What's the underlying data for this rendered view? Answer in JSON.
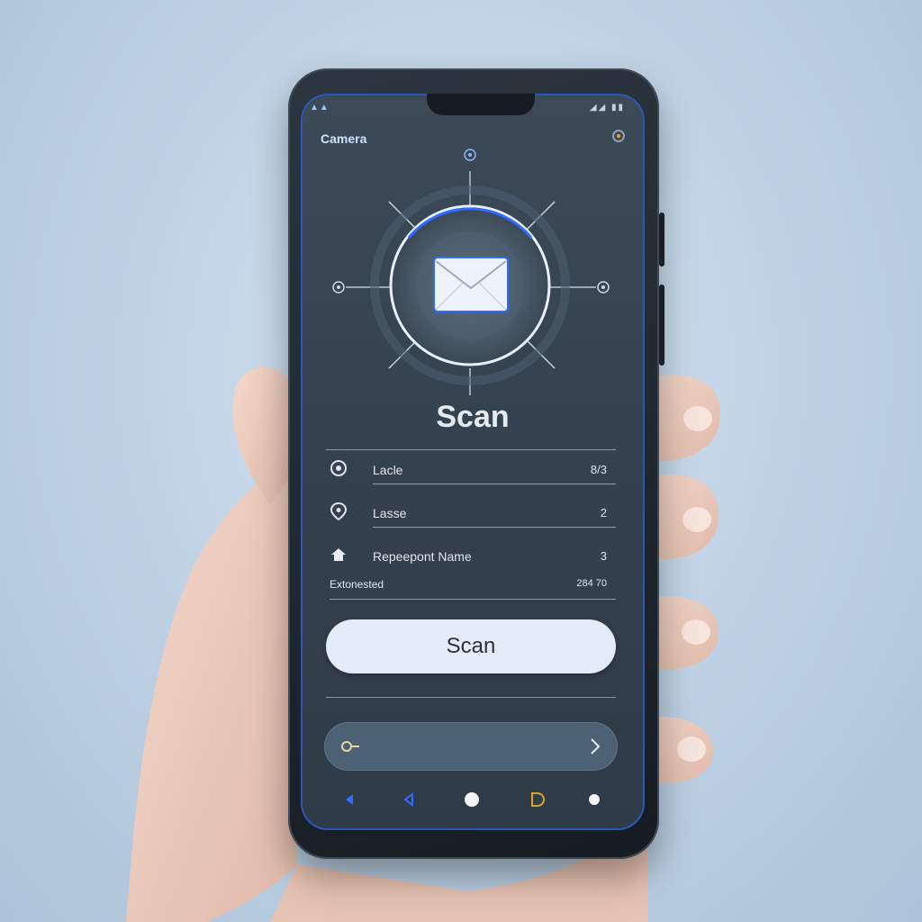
{
  "status_bar": {
    "left": "▲▲",
    "right": "◢◢ ▮▮"
  },
  "app": {
    "title": "Camera"
  },
  "main": {
    "heading": "Scan",
    "rows": [
      {
        "label": "Lacle",
        "value": "8/3"
      },
      {
        "label": "Lasse",
        "value": "2"
      },
      {
        "label": "Repeepont Name",
        "value": "3"
      },
      {
        "label": "Extonested",
        "value": "284 70"
      }
    ],
    "primary_button": "Scan"
  },
  "colors": {
    "accent": "#2f6bff",
    "screen_bg": "#36434f",
    "button_bg": "#e3edf8",
    "search_bar_bg": "#4d6174"
  },
  "icons": {
    "scanner": "envelope-icon",
    "row_1": "target-icon",
    "row_2": "location-pin-icon",
    "row_3": "home-icon",
    "search": "key-icon",
    "chevron": "chevron-right-icon"
  }
}
